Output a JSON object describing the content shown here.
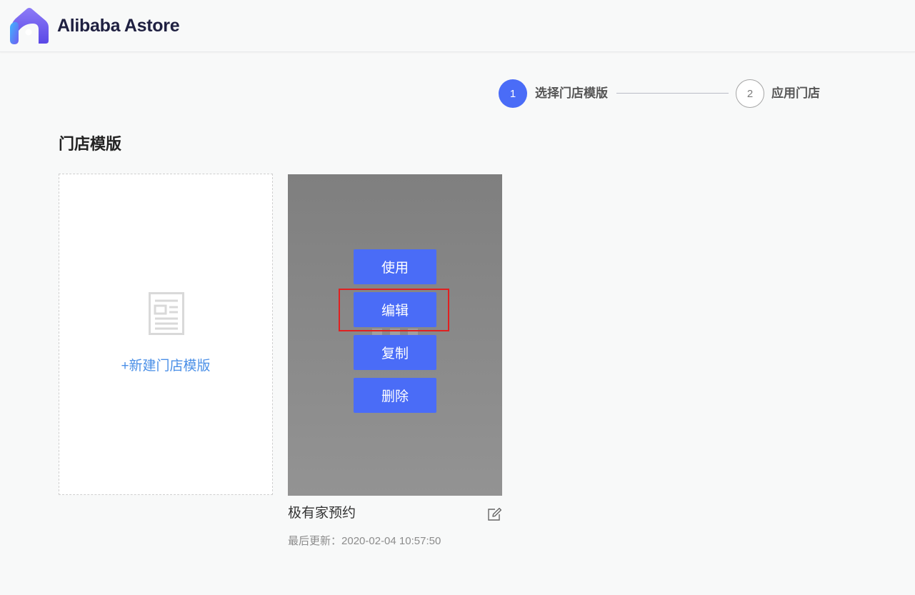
{
  "brand": {
    "name": "Alibaba Astore",
    "logo_icon": "alibaba-astore-logo"
  },
  "steps": [
    {
      "number": "1",
      "label": "选择门店模版",
      "state": "active"
    },
    {
      "number": "2",
      "label": "应用门店",
      "state": "inactive"
    }
  ],
  "section": {
    "title": "门店模版"
  },
  "new_template": {
    "label": "+新建门店模版",
    "icon": "document-icon"
  },
  "templates": [
    {
      "name": "极有家预约",
      "updated_label": "最后更新：",
      "updated_value": "2020-02-04 10:57:50",
      "actions": [
        "使用",
        "编辑",
        "复制",
        "删除"
      ],
      "highlighted_action": "编辑"
    }
  ],
  "colors": {
    "accent": "#4a6cf7",
    "link": "#4a8fe7",
    "highlight_border": "#e02020",
    "overlay": "#8a8a8a"
  }
}
